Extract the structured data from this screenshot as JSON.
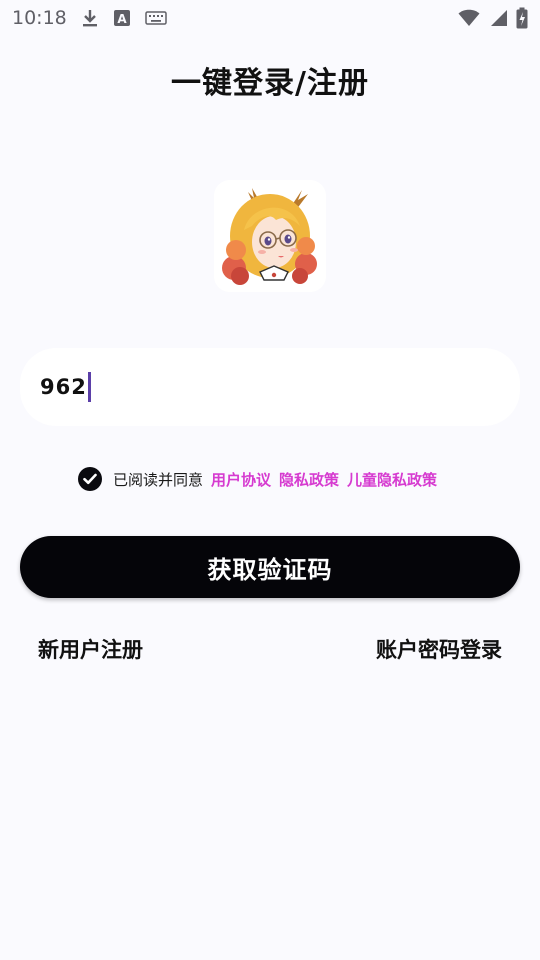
{
  "status_bar": {
    "time": "10:18",
    "left_icons": [
      "download-icon",
      "translate-icon",
      "keyboard-icon"
    ],
    "right_icons": [
      "wifi-icon",
      "signal-icon",
      "battery-charging-icon"
    ]
  },
  "page": {
    "title": "一键登录/注册"
  },
  "form": {
    "phone_value": "962",
    "agree_prefix": "已阅读并同意",
    "links": [
      "用户协议",
      "隐私政策",
      "儿童隐私政策"
    ],
    "agreed": true,
    "submit_label": "获取验证码"
  },
  "footer": {
    "register_label": "新用户注册",
    "password_login_label": "账户密码登录"
  },
  "colors": {
    "background": "#fafafe",
    "accent_link": "#d63bd0",
    "button": "#050509",
    "caret": "#5b3fa8"
  }
}
